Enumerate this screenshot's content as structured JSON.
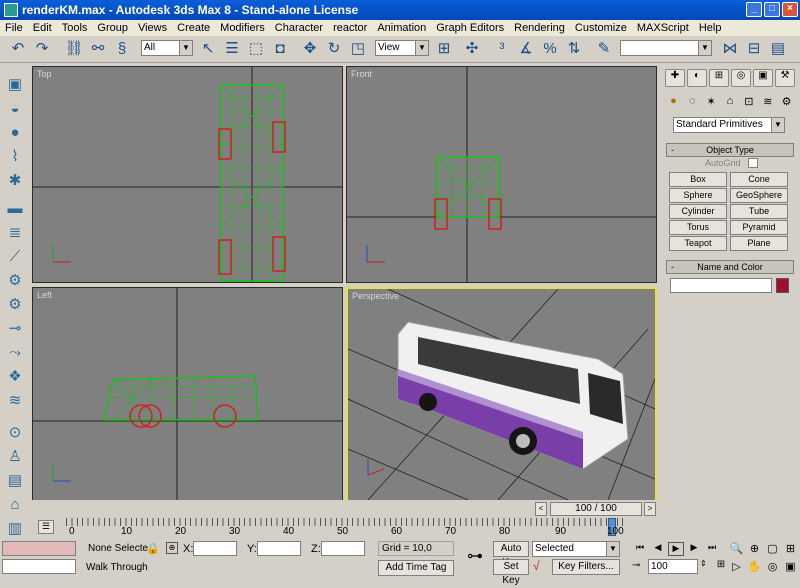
{
  "window": {
    "title": "renderKM.max - Autodesk 3ds Max 8   - Stand-alone License"
  },
  "menu": [
    "File",
    "Edit",
    "Tools",
    "Group",
    "Views",
    "Create",
    "Modifiers",
    "Character",
    "reactor",
    "Animation",
    "Graph Editors",
    "Rendering",
    "Customize",
    "MAXScript",
    "Help"
  ],
  "toolbar": {
    "selection_filter": "All",
    "ref_coord": "View",
    "named_sel": ""
  },
  "viewports": {
    "top": "Top",
    "front": "Front",
    "left": "Left",
    "perspective": "Perspective"
  },
  "panel": {
    "category": "Standard Primitives",
    "object_type_header": "Object Type",
    "autogrid": "AutoGrid",
    "buttons": [
      "Box",
      "Cone",
      "Sphere",
      "GeoSphere",
      "Cylinder",
      "Tube",
      "Torus",
      "Pyramid",
      "Teapot",
      "Plane"
    ],
    "name_color_header": "Name and Color",
    "color": "#a0102a"
  },
  "timeline": {
    "frame": "100 / 100",
    "ticks": [
      "0",
      "10",
      "20",
      "30",
      "40",
      "50",
      "60",
      "70",
      "80",
      "90",
      "100"
    ]
  },
  "status": {
    "selection": "None Selecte",
    "x_label": "X:",
    "y_label": "Y:",
    "z_label": "Z:",
    "grid": "Grid = 10,0",
    "prompt": "Walk Through",
    "add_time_tag": "Add Time Tag",
    "auto_key": "Auto Key",
    "set_key": "Set Key",
    "key_mode": "Selected",
    "key_filters": "Key Filters...",
    "current_frame": "100"
  }
}
